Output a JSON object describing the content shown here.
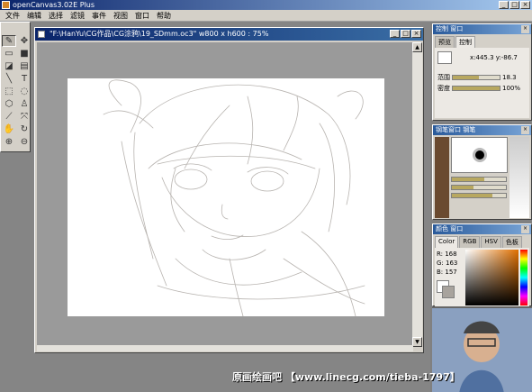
{
  "app": {
    "title": "openCanvas3.02E Plus"
  },
  "menu": [
    "文件",
    "编辑",
    "选择",
    "滤镜",
    "事件",
    "视图",
    "窗口",
    "帮助"
  ],
  "document": {
    "title": "\"F:\\HanYu\\CG作品\\CG涂鸦\\19_SDmm.oc3\" w800 x h600 : 75%"
  },
  "control_panel": {
    "title": "控制 窗口",
    "tabs": [
      "预览",
      "控制"
    ],
    "coords": "x:445.3  y:-86.7",
    "range_label": "范围",
    "range_value": "18.3",
    "density_label": "密度",
    "density_value": "100%",
    "range_fill": 0.55,
    "density_fill": 1.0
  },
  "brush_panel": {
    "title": "钢笔窗口",
    "tab": "钢笔"
  },
  "color_panel": {
    "title": "颜色 窗口",
    "tabs": [
      "Color",
      "RGB",
      "HSV",
      "色板"
    ],
    "r": "R: 168",
    "g": "G: 163",
    "b": "B: 157"
  },
  "watermark": {
    "text": "原画绘画吧  【www.linecg.com/tieba-1797】"
  },
  "colors": {
    "titlebar": "#0a246a",
    "panel": "#d4d0c8",
    "sketch": "#b8b4b0"
  }
}
